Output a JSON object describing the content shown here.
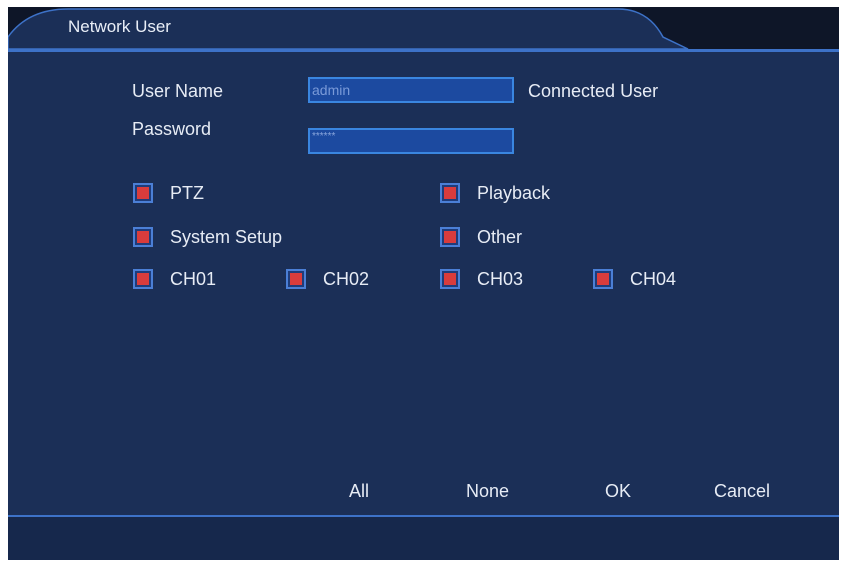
{
  "window": {
    "title": "Network User"
  },
  "form": {
    "username_label": "User Name",
    "username_value": "admin",
    "connected_label": "Connected User",
    "password_label": "Password",
    "password_value": "******"
  },
  "permissions": [
    {
      "label": "PTZ",
      "checked": true
    },
    {
      "label": "Playback",
      "checked": true
    },
    {
      "label": "System Setup",
      "checked": true
    },
    {
      "label": "Other",
      "checked": true
    },
    {
      "label": "CH01",
      "checked": true
    },
    {
      "label": "CH02",
      "checked": true
    },
    {
      "label": "CH03",
      "checked": true
    },
    {
      "label": "CH04",
      "checked": true
    }
  ],
  "buttons": {
    "all": "All",
    "none": "None",
    "ok": "OK",
    "cancel": "Cancel"
  },
  "colors": {
    "panel": "#1b2f57",
    "accent": "#3d72c8",
    "checkbox_mark": "#d93c3c"
  }
}
